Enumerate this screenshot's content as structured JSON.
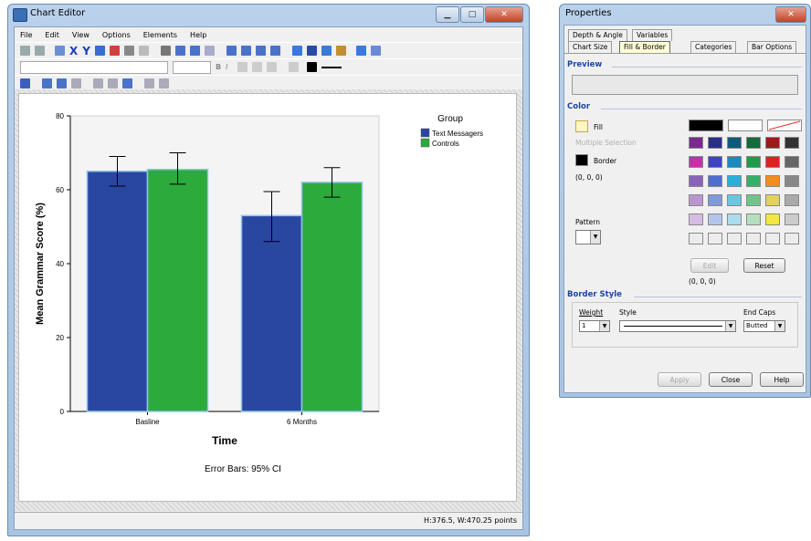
{
  "chart_editor": {
    "title": "Chart Editor",
    "menu": [
      "File",
      "Edit",
      "View",
      "Options",
      "Elements",
      "Help"
    ],
    "status": "H:376.5, W:470.25 points",
    "toolbar_text": {
      "bold": "B",
      "italic": "I"
    }
  },
  "chart_data": {
    "type": "bar",
    "categories": [
      "Basline",
      "6 Months"
    ],
    "series": [
      {
        "name": "Text Messagers",
        "color": "#2947a1",
        "values": [
          65,
          53
        ],
        "ci_low": [
          61,
          46
        ],
        "ci_high": [
          69,
          59.5
        ]
      },
      {
        "name": "Controls",
        "color": "#2caa3c",
        "values": [
          65.5,
          62
        ],
        "ci_low": [
          61.5,
          58
        ],
        "ci_high": [
          70,
          66
        ]
      }
    ],
    "xlabel": "Time",
    "ylabel": "Mean Grammar Score (%)",
    "ylim": [
      0,
      80
    ],
    "yticks": [
      "0",
      "20",
      "40",
      "60",
      "80"
    ],
    "legend_title": "Group",
    "legend_position": "top-right",
    "footnote": "Error Bars: 95% CI"
  },
  "properties": {
    "title": "Properties",
    "tabs_row1": [
      "Depth & Angle",
      "Variables"
    ],
    "tabs_row2": [
      "Chart Size",
      "Fill & Border",
      "Categories",
      "Bar Options"
    ],
    "preview_label": "Preview",
    "color_label": "Color",
    "fill_label": "Fill",
    "multiple_selection": "Multiple Selection",
    "border_label": "Border",
    "border_rgb": "(0, 0, 0)",
    "pattern_label": "Pattern",
    "edit_label": "Edit",
    "reset_label": "Reset",
    "rgb_readout": "(0, 0, 0)",
    "border_style_label": "Border Style",
    "weight_label": "Weight",
    "weight_value": "1",
    "style_label": "Style",
    "endcaps_label": "End Caps",
    "endcaps_value": "Butted",
    "apply_label": "Apply",
    "close_label": "Close",
    "help_label": "Help",
    "palette": [
      [
        "#7a2a8e",
        "#2a2f87",
        "#0f5a7a",
        "#116b3a",
        "#9c1a1a",
        "#333333"
      ],
      [
        "#c62fa8",
        "#3d43c7",
        "#1a8ac0",
        "#1b9e4a",
        "#e02020",
        "#666666"
      ],
      [
        "#8a63b8",
        "#4f6ed0",
        "#28b0d8",
        "#33b06a",
        "#f08c20",
        "#888888"
      ],
      [
        "#b996d0",
        "#7f9ad8",
        "#6cc6e0",
        "#71c48c",
        "#e2d060",
        "#aaaaaa"
      ],
      [
        "#d6bce2",
        "#b2c4ec",
        "#aadcee",
        "#b2e0be",
        "#f2e640",
        "#cccccc"
      ],
      [
        "#ececec",
        "#ececec",
        "#ececec",
        "#ececec",
        "#ececec",
        "#ececec"
      ]
    ]
  }
}
